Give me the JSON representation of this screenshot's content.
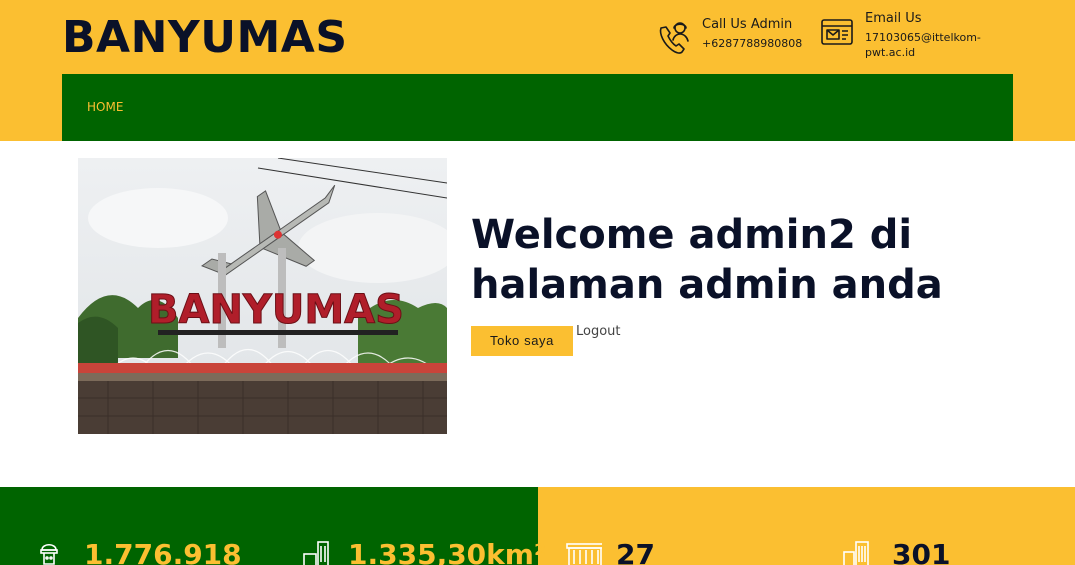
{
  "header": {
    "brand": "BANYUMAS",
    "phone": {
      "label": "Call Us Admin",
      "value": "+6287788980808"
    },
    "email": {
      "label": "Email Us",
      "value": "17103065@ittelkom-pwt.ac.id"
    }
  },
  "nav": {
    "items": [
      {
        "label": "HOME"
      }
    ]
  },
  "hero": {
    "image_caption": "BANYUMAS",
    "welcome": "Welcome admin2 di halaman admin anda",
    "toko_button": "Toko saya",
    "logout": "Logout"
  },
  "stats": [
    {
      "value": "1.776.918"
    },
    {
      "value": "1.335,30km²"
    },
    {
      "value": "27"
    },
    {
      "value": "301"
    }
  ],
  "colors": {
    "accent": "#fbbf31",
    "green": "#006400",
    "dark": "#0a1128"
  }
}
